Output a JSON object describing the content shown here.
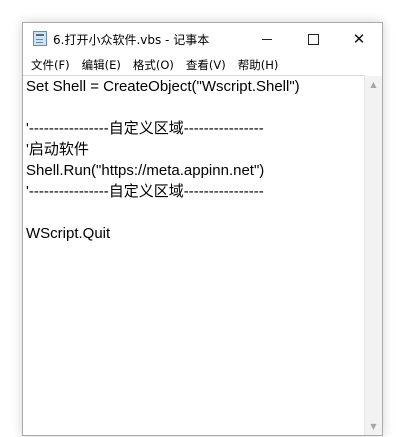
{
  "window": {
    "title": "6.打开小众软件.vbs - 记事本",
    "controls": {
      "minimize_icon": "minimize-icon",
      "maximize_icon": "maximize-icon",
      "close_symbol": "✕"
    }
  },
  "menu": {
    "items": [
      {
        "label": "文件(F)"
      },
      {
        "label": "编辑(E)"
      },
      {
        "label": "格式(O)"
      },
      {
        "label": "查看(V)"
      },
      {
        "label": "帮助(H)"
      }
    ]
  },
  "editor": {
    "lines": [
      "Set Shell = CreateObject(\"Wscript.Shell\")",
      "",
      "'----------------自定义区域----------------",
      "'启动软件",
      "Shell.Run(\"https://meta.appinn.net\")",
      "'----------------自定义区域----------------",
      "",
      "WScript.Quit"
    ]
  },
  "scrollbar": {
    "up_arrow": "▲",
    "down_arrow": "▼"
  }
}
